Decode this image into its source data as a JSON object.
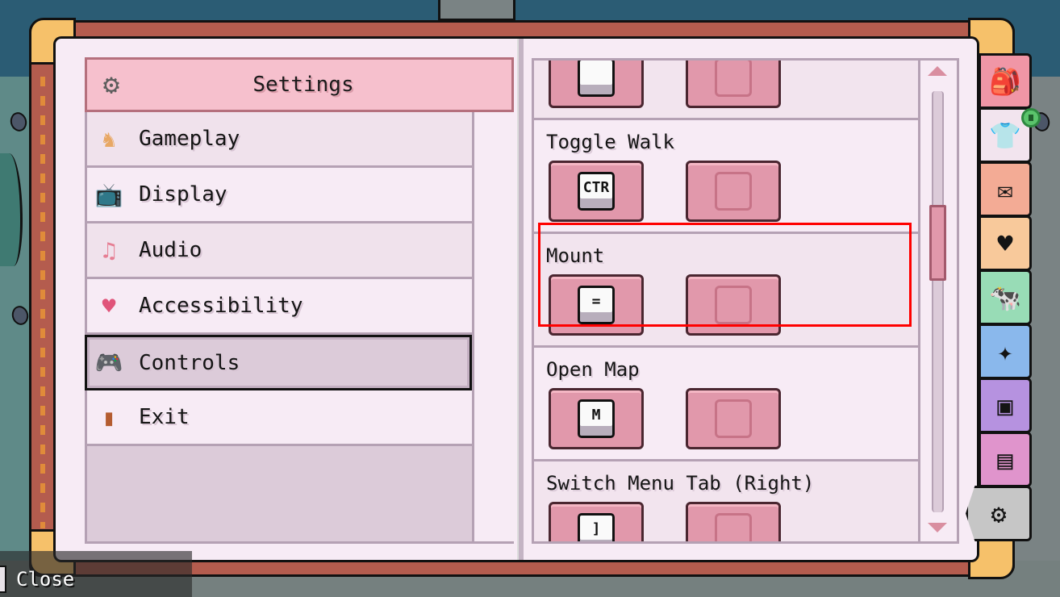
{
  "window": {
    "title": "Settings"
  },
  "menu": {
    "header": {
      "icon": "gear-icon",
      "title": "Settings"
    },
    "items": [
      {
        "label": "Gameplay",
        "icon": "chess-knight-icon",
        "glyph": "♞",
        "color": "#e8a865"
      },
      {
        "label": "Display",
        "icon": "tv-icon",
        "glyph": "📺",
        "color": "#b4602f"
      },
      {
        "label": "Audio",
        "icon": "music-note-icon",
        "glyph": "♫",
        "color": "#e67e93"
      },
      {
        "label": "Accessibility",
        "icon": "heart-icon",
        "glyph": "♥",
        "color": "#e0547a"
      },
      {
        "label": "Controls",
        "icon": "gamepad-icon",
        "glyph": "🎮",
        "color": "#9a9aa0",
        "active": true
      },
      {
        "label": "Exit",
        "icon": "door-icon",
        "glyph": "▮",
        "color": "#b45c30"
      }
    ]
  },
  "controls": {
    "rows": [
      {
        "label": "",
        "primary_key": "",
        "secondary_key": ""
      },
      {
        "label": "Toggle Walk",
        "primary_key": "CTR",
        "secondary_key": ""
      },
      {
        "label": "Mount",
        "primary_key": "=",
        "secondary_key": "",
        "highlighted": true
      },
      {
        "label": "Open Map",
        "primary_key": "M",
        "secondary_key": ""
      },
      {
        "label": "Switch Menu Tab (Right)",
        "primary_key": "]",
        "secondary_key": ""
      }
    ],
    "scroll_position": 0.33
  },
  "tabs": [
    {
      "name": "inventory",
      "icon": "backpack-icon",
      "glyph": "🎒",
      "color": "#f096a6"
    },
    {
      "name": "character",
      "icon": "outfit-icon",
      "glyph": "👕",
      "color": "#f2e4ee",
      "badge": true
    },
    {
      "name": "mail",
      "icon": "mail-icon",
      "glyph": "✉",
      "color": "#f3ab95"
    },
    {
      "name": "relationships",
      "icon": "heart-icon",
      "glyph": "♥",
      "color": "#f8c99b"
    },
    {
      "name": "animals",
      "icon": "cow-icon",
      "glyph": "🐄",
      "color": "#98dcb6"
    },
    {
      "name": "skills",
      "icon": "sparkle-icon",
      "glyph": "✦",
      "color": "#8ab8ec"
    },
    {
      "name": "map",
      "icon": "map-icon",
      "glyph": "▣",
      "color": "#b692e0"
    },
    {
      "name": "journal",
      "icon": "journal-icon",
      "glyph": "▤",
      "color": "#e094cc"
    },
    {
      "name": "settings",
      "icon": "gear-icon",
      "glyph": "⚙",
      "color": "#c6c6c6",
      "active": true
    }
  ],
  "footer": {
    "close_label": "Close"
  }
}
